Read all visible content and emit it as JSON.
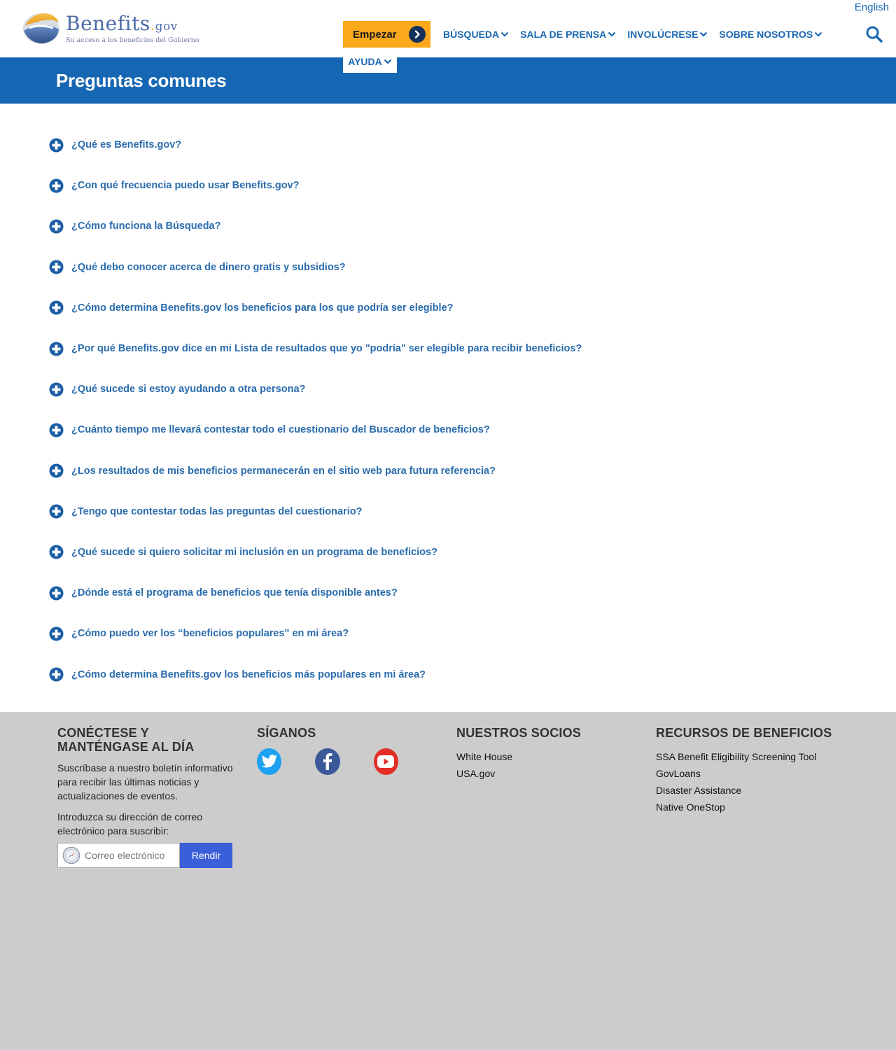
{
  "header": {
    "language_link": "English",
    "logo": {
      "wordmark_main": "Benefits",
      "wordmark_dot": ".",
      "wordmark_suffix": "gov",
      "tagline": "Su acceso a los beneficios del Gobierno"
    },
    "start_button": "Empezar",
    "nav": [
      {
        "label": "BÚSQUEDA"
      },
      {
        "label": "SALA DE PRENSA"
      },
      {
        "label": "INVOLÚCRESE"
      },
      {
        "label": "SOBRE NOSOTROS"
      }
    ],
    "nav_help": "AYUDA",
    "search_icon": "magnifier-icon"
  },
  "banner": {
    "title": "Preguntas comunes"
  },
  "faq": [
    "¿Qué es Benefits.gov?",
    "¿Con qué frecuencia puedo usar Benefits.gov?",
    "¿Cómo funciona la Búsqueda?",
    "¿Qué debo conocer acerca de dinero gratis y subsidios?",
    "¿Cómo determina Benefits.gov los beneficios para los que podría ser elegible?",
    "¿Por qué Benefits.gov dice en mi Lista de resultados que yo \"podría\" ser elegible para recibir beneficios?",
    "¿Qué sucede si estoy ayudando a otra persona?",
    "¿Cuánto tiempo me llevará contestar todo el cuestionario del Buscador de beneficios?",
    "¿Los resultados de mis beneficios permanecerán en el sitio web para futura referencia?",
    "¿Tengo que contestar todas las preguntas del cuestionario?",
    "¿Qué sucede si quiero solicitar mi inclusión en un programa de beneficios?",
    "¿Dónde está el programa de beneficios que tenía disponible antes?",
    "¿Cómo puedo ver los “beneficios populares\" en mi área?",
    "¿Cómo determina Benefits.gov los beneficios más populares en mi área?"
  ],
  "footer": {
    "connect": {
      "heading": "CONÉCTESE Y MANTÉNGASE AL DÍA",
      "description": "Suscríbase a nuestro boletín informativo para recibir las últimas noticias y actualizaciones de eventos.",
      "email_label": "Introduzca su dirección de correo electrónico para suscribir:",
      "email_placeholder": "Correo electrónico",
      "submit_label": "Rendir"
    },
    "follow": {
      "heading": "SÍGANOS",
      "icons": [
        "twitter-icon",
        "facebook-icon",
        "youtube-icon"
      ]
    },
    "partners": {
      "heading": "NUESTROS SOCIOS",
      "links": [
        "White House",
        "USA.gov"
      ]
    },
    "resources": {
      "heading": "RECURSOS DE BENEFICIOS",
      "links": [
        "SSA Benefit Eligibility Screening Tool",
        "GovLoans",
        "Disaster Assistance",
        "Native OneStop"
      ]
    }
  },
  "colors": {
    "brand_blue": "#1667b3",
    "link_blue": "#2a6cad",
    "accent_orange": "#fba81b",
    "footer_gray": "#cccccc",
    "submit_blue": "#3a5fd9",
    "twitter": "#1da1f2",
    "facebook": "#3b5998",
    "youtube": "#e52d27"
  }
}
